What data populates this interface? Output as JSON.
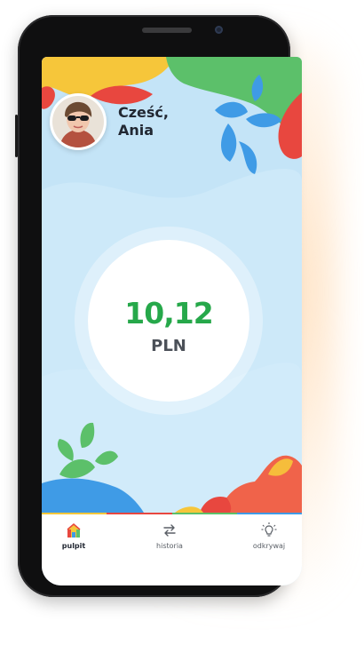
{
  "greeting": {
    "line1": "Cześć,",
    "line2": "Ania"
  },
  "balance": {
    "amount": "10,12",
    "currency": "PLN"
  },
  "nav": {
    "items": [
      {
        "label": "pulpit",
        "icon": "home-icon",
        "active": true
      },
      {
        "label": "historia",
        "icon": "arrows-exchange-icon",
        "active": false
      },
      {
        "label": "odkrywaj",
        "icon": "lightbulb-icon",
        "active": false
      }
    ]
  },
  "colors": {
    "balance_green": "#26a84a",
    "screen_bg": "#c4e4f7",
    "accent_yellow": "#f6c63a",
    "accent_red": "#e8473f",
    "accent_green": "#5cc06a",
    "accent_blue": "#3f9be6"
  }
}
